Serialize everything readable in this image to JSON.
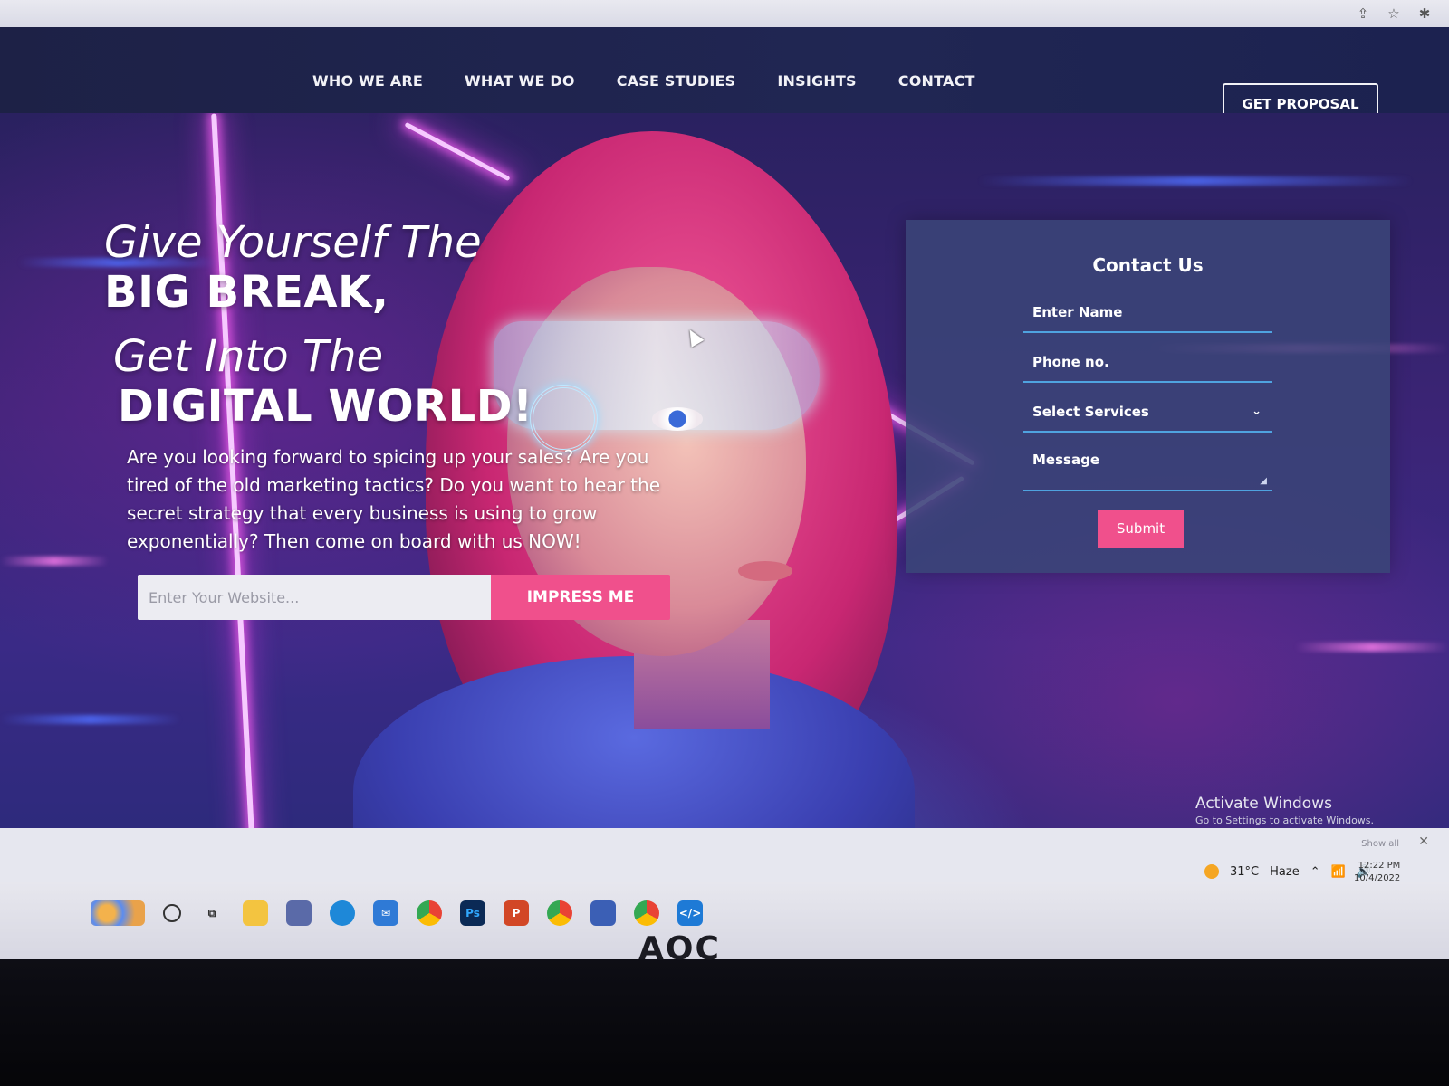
{
  "nav": {
    "items": [
      "WHO WE ARE",
      "WHAT WE DO",
      "CASE STUDIES",
      "INSIGHTS",
      "CONTACT"
    ],
    "cta": "GET PROPOSAL"
  },
  "hero": {
    "line1": "Give Yourself The",
    "line2": "BIG BREAK,",
    "line3": "Get Into The",
    "line4": "DIGITAL WORLD!",
    "lead": "Are you looking forward to spicing up your sales? Are you tired of the old marketing tactics? Do you want to hear the secret strategy that every business is using to grow exponentially? Then come on board with us NOW!",
    "website_placeholder": "Enter Your Website...",
    "impress_label": "IMPRESS ME"
  },
  "contact": {
    "title": "Contact Us",
    "name_placeholder": "Enter Name",
    "phone_placeholder": "Phone no.",
    "services_label": "Select Services",
    "message_placeholder": "Message",
    "submit_label": "Submit"
  },
  "windows": {
    "activate_title": "Activate Windows",
    "activate_sub": "Go to Settings to activate Windows.",
    "show_all": "Show all"
  },
  "tray": {
    "weather": "31°C",
    "condition": "Haze",
    "time": "12:22 PM",
    "date": "10/4/2022"
  },
  "taskbar": {
    "icons": [
      "search-circle-icon",
      "task-view-icon",
      "file-explorer-icon",
      "store-icon",
      "edge-icon",
      "mail-icon",
      "chrome-icon",
      "photoshop-icon",
      "powerpoint-icon",
      "chrome-profile-icon",
      "app-icon",
      "chrome-alt-icon",
      "vscode-icon"
    ],
    "ps_label": "Ps",
    "ppt_label": "P"
  },
  "monitor": {
    "brand": "AOC"
  },
  "colors": {
    "accent_pink": "#f0508c",
    "header_bg": "#1d2146",
    "form_underline": "#4fa3e0"
  }
}
